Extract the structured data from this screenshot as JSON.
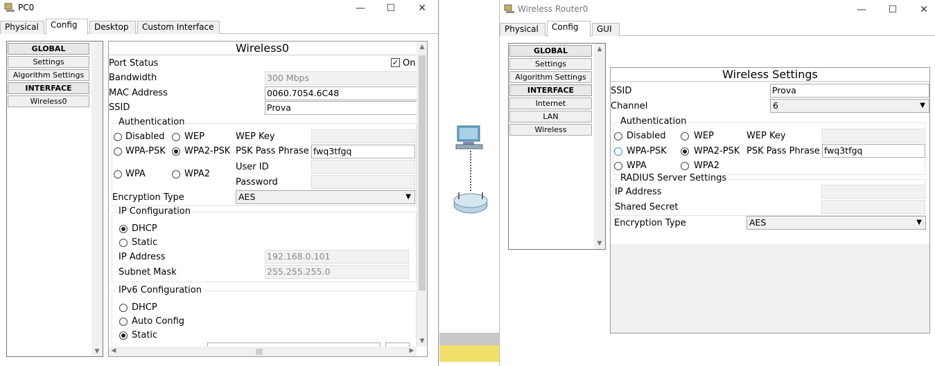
{
  "pc": {
    "title": "PC0",
    "tabs": [
      "Physical",
      "Config",
      "Desktop",
      "Custom Interface"
    ],
    "sidebar": {
      "global": "GLOBAL",
      "settings": "Settings",
      "algorithm": "Algorithm Settings",
      "interface": "INTERFACE",
      "wireless": "Wireless0"
    },
    "panel_title": "Wireless0",
    "port_status_label": "Port Status",
    "port_status_value": "On",
    "bandwidth_label": "Bandwidth",
    "bandwidth_value": "300 Mbps",
    "mac_label": "MAC Address",
    "mac_value": "0060.7054.6C48",
    "ssid_label": "SSID",
    "ssid_value": "Prova",
    "auth_title": "Authentication",
    "auth": {
      "disabled": "Disabled",
      "wep": "WEP",
      "wpapsk": "WPA-PSK",
      "wpa2psk": "WPA2-PSK",
      "wpa": "WPA",
      "wpa2": "WPA2"
    },
    "wep_key_label": "WEP Key",
    "psk_label": "PSK Pass Phrase",
    "psk_value": "fwq3tfgq",
    "userid_label": "User ID",
    "password_label": "Password",
    "enc_label": "Encryption Type",
    "enc_value": "AES",
    "ip_title": "IP Configuration",
    "ip_dhcp": "DHCP",
    "ip_static": "Static",
    "ip_addr_label": "IP Address",
    "ip_addr_value": "192.168.0.101",
    "mask_label": "Subnet Mask",
    "mask_value": "255.255.255.0",
    "ipv6_title": "IPv6 Configuration",
    "ipv6_dhcp": "DHCP",
    "ipv6_auto": "Auto Config",
    "ipv6_static": "Static"
  },
  "router": {
    "title": "Wireless Router0",
    "tabs": [
      "Physical",
      "Config",
      "GUI"
    ],
    "sidebar": {
      "global": "GLOBAL",
      "settings": "Settings",
      "algorithm": "Algorithm Settings",
      "interface": "INTERFACE",
      "internet": "Internet",
      "lan": "LAN",
      "wireless": "Wireless"
    },
    "panel_title": "Wireless Settings",
    "ssid_label": "SSID",
    "ssid_value": "Prova",
    "channel_label": "Channel",
    "channel_value": "6",
    "auth_title": "Authentication",
    "auth": {
      "disabled": "Disabled",
      "wep": "WEP",
      "wpapsk": "WPA-PSK",
      "wpa2psk": "WPA2-PSK",
      "wpa": "WPA",
      "wpa2": "WPA2"
    },
    "wep_key_label": "WEP Key",
    "psk_label": "PSK Pass Phrase",
    "psk_value": "fwq3tfgq",
    "radius_title": "RADIUS Server Settings",
    "ip_label": "IP Address",
    "secret_label": "Shared Secret",
    "enc_label": "Encryption Type",
    "enc_value": "AES"
  },
  "window_controls": {
    "minimize": "—",
    "maximize": "☐",
    "close": "✕"
  }
}
